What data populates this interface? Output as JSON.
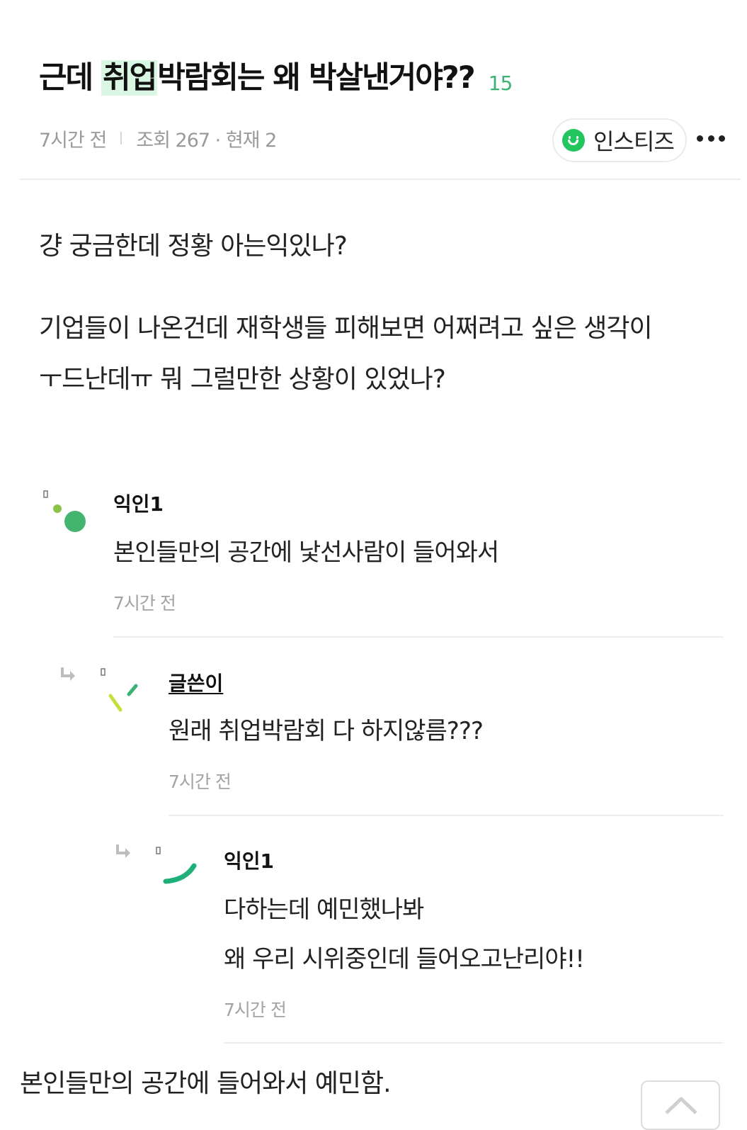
{
  "post": {
    "title_before": "근데 ",
    "title_highlight": "취업",
    "title_after": "박람회는 왜 박살낸거야??",
    "comment_count": "15",
    "time": "7시간 전",
    "views": "조회 267 · 현재 2",
    "board": "인스티즈",
    "body": [
      "걍 궁금한데 정황 아는익있나?",
      "기업들이 나온건데 재학생들 피해보면 어쩌려고 싶은 생각이",
      "ㅜ드난데ㅠ 뭐 그럴만한 상황이 있었나?"
    ]
  },
  "comments": [
    {
      "name": "익인1",
      "lines": [
        "본인들만의 공간에 낯선사람이 들어와서"
      ],
      "time": "7시간 전"
    },
    {
      "name": "글쓴이",
      "lines": [
        "원래 취업박람회 다 하지않름???"
      ],
      "time": "7시간 전"
    },
    {
      "name": "익인1",
      "lines": [
        "다하는데 예민했나봐",
        "왜 우리 시위중인데 들어오고난리야!!"
      ],
      "time": "7시간 전"
    }
  ],
  "bottom_text": "본인들만의 공간에 들어와서 예민함.",
  "colors": {
    "accent": "#3bb273",
    "highlight": "#d9f7e2",
    "board_icon": "#22c55e"
  }
}
